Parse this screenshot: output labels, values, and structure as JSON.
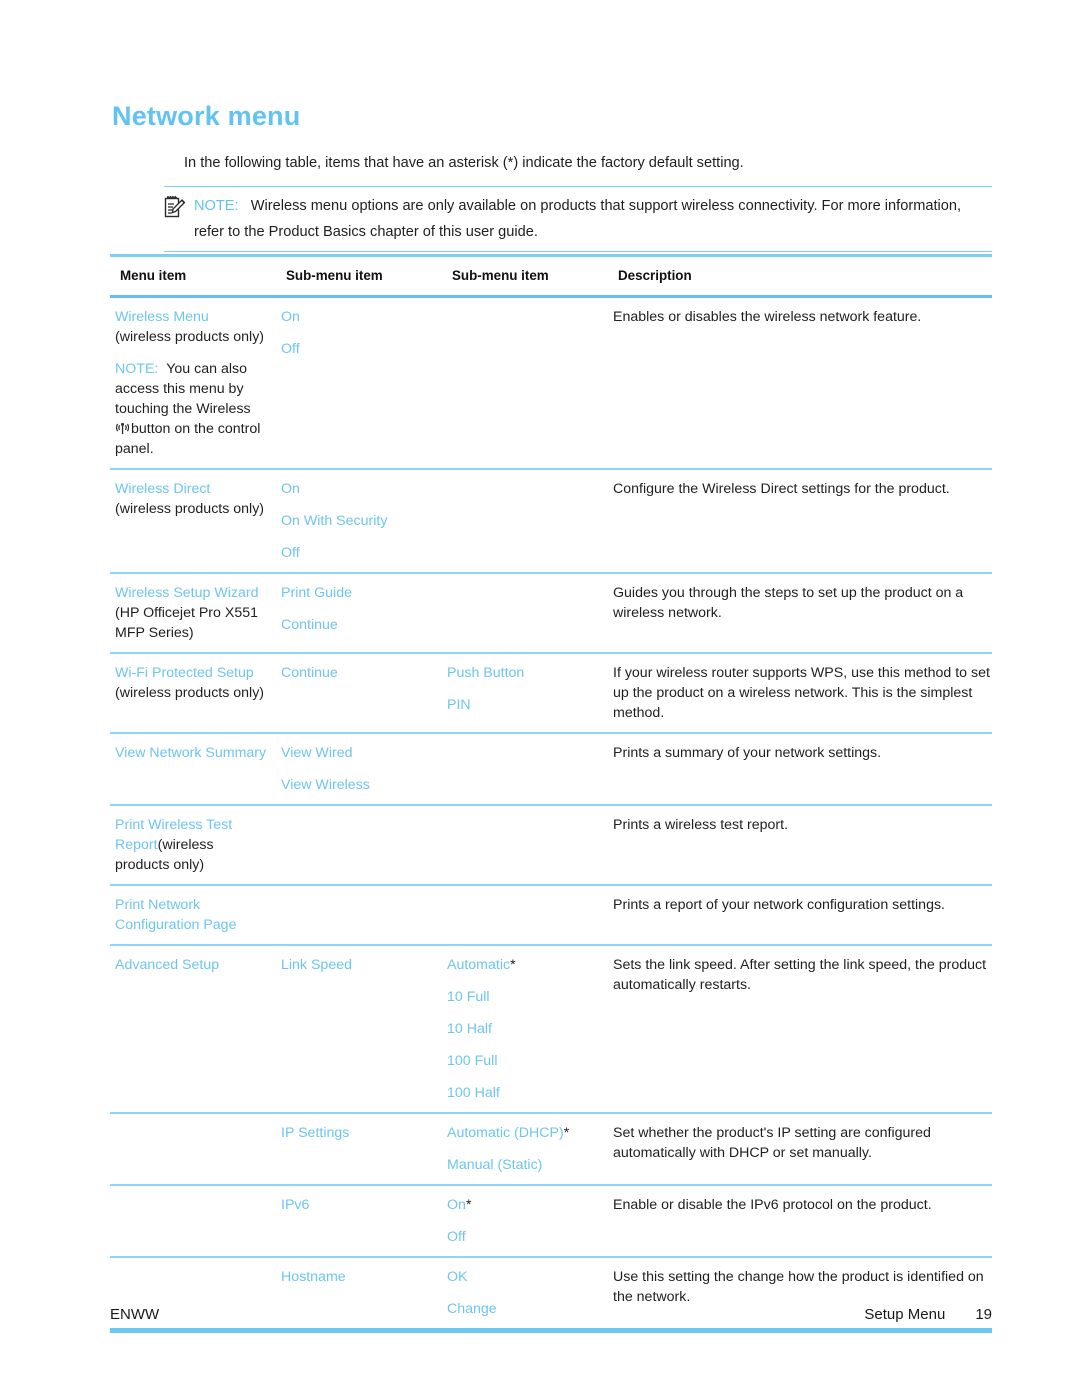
{
  "page": {
    "heading": "Network menu",
    "intro": "In the following table, items that have an asterisk (*) indicate the factory default setting."
  },
  "note": {
    "icon": "note-clipboard-pencil-icon",
    "label": "NOTE:",
    "text": "Wireless menu options are only available on products that support wireless connectivity. For more information, refer to the Product Basics chapter of this user guide."
  },
  "table": {
    "headers": {
      "col1": "Menu item",
      "col2": "Sub-menu item",
      "col3": "Sub-menu item",
      "col4": "Description"
    },
    "rows": [
      {
        "menu_item_link": "Wireless Menu",
        "menu_item_note_black": "(wireless products only)",
        "menu_item_note_label": "NOTE:",
        "menu_item_note_body_a": "You can also access this menu by touching the Wireless",
        "menu_item_note_icon": "wireless-antenna-icon",
        "menu_item_note_body_b": "button on the control panel.",
        "sub1_a": "On",
        "sub1_b": "Off",
        "sub2": "",
        "description": "Enables or disables the wireless network feature."
      },
      {
        "menu_item_link": "Wireless Direct",
        "menu_item_note_black": "(wireless products only)",
        "sub1_a": "On",
        "sub1_b": "On With Security",
        "sub1_c": "Off",
        "sub2": "",
        "description": "Configure the Wireless Direct settings for the product."
      },
      {
        "menu_item_link": "Wireless Setup Wizard",
        "menu_item_note_black": "(HP Officejet Pro X551 MFP Series)",
        "sub1_a": "Print Guide",
        "sub1_b": "Continue",
        "sub2": "",
        "description": "Guides you through the steps to set up the product on a wireless network."
      },
      {
        "menu_item_link": "Wi-Fi Protected Setup",
        "menu_item_note_black": "(wireless products only)",
        "sub1_a": "Continue",
        "sub2_a": "Push Button",
        "sub2_b": "PIN",
        "description": "If your wireless router supports WPS, use this method to set up the product on a wireless network. This is the simplest method."
      },
      {
        "menu_item_link": "View Network Summary",
        "sub1_a": "View Wired",
        "sub1_b": "View Wireless",
        "sub2": "",
        "description": "Prints a summary of your network settings."
      },
      {
        "menu_item_link": "Print Wireless Test Report",
        "menu_item_note_black": "(wireless products only)",
        "sub1_a": "",
        "sub2": "",
        "description": "Prints a wireless test report."
      },
      {
        "menu_item_link": "Print Network Configuration Page",
        "sub1_a": "",
        "sub2": "",
        "description": "Prints a report of your network configuration settings."
      },
      {
        "menu_item_link": "Advanced Setup",
        "sub1_a": "Link Speed",
        "sub2_a": "Automatic",
        "sub2_a_asterisk": "*",
        "sub2_b": "10 Full",
        "sub2_c": "10 Half",
        "sub2_d": "100 Full",
        "sub2_e": "100 Half",
        "description": "Sets the link speed. After setting the link speed, the product automatically restarts."
      },
      {
        "menu_item_link": "",
        "sub1_a": "IP Settings",
        "sub2_a": "Automatic (DHCP)",
        "sub2_a_asterisk": "*",
        "sub2_b": "Manual (Static)",
        "description": "Set whether the product's IP setting are configured automatically with DHCP or set manually."
      },
      {
        "menu_item_link": "",
        "sub1_a": "IPv6",
        "sub2_a": "On",
        "sub2_a_asterisk": "*",
        "sub2_b": "Off",
        "description": "Enable or disable the IPv6 protocol on the product."
      },
      {
        "menu_item_link": "",
        "sub1_a": "Hostname",
        "sub2_a": "OK",
        "sub2_b": "Change",
        "description": "Use this setting the change how the product is identified on the network."
      }
    ]
  },
  "footer": {
    "left": "ENWW",
    "section": "Setup Menu",
    "page_number": "19"
  }
}
